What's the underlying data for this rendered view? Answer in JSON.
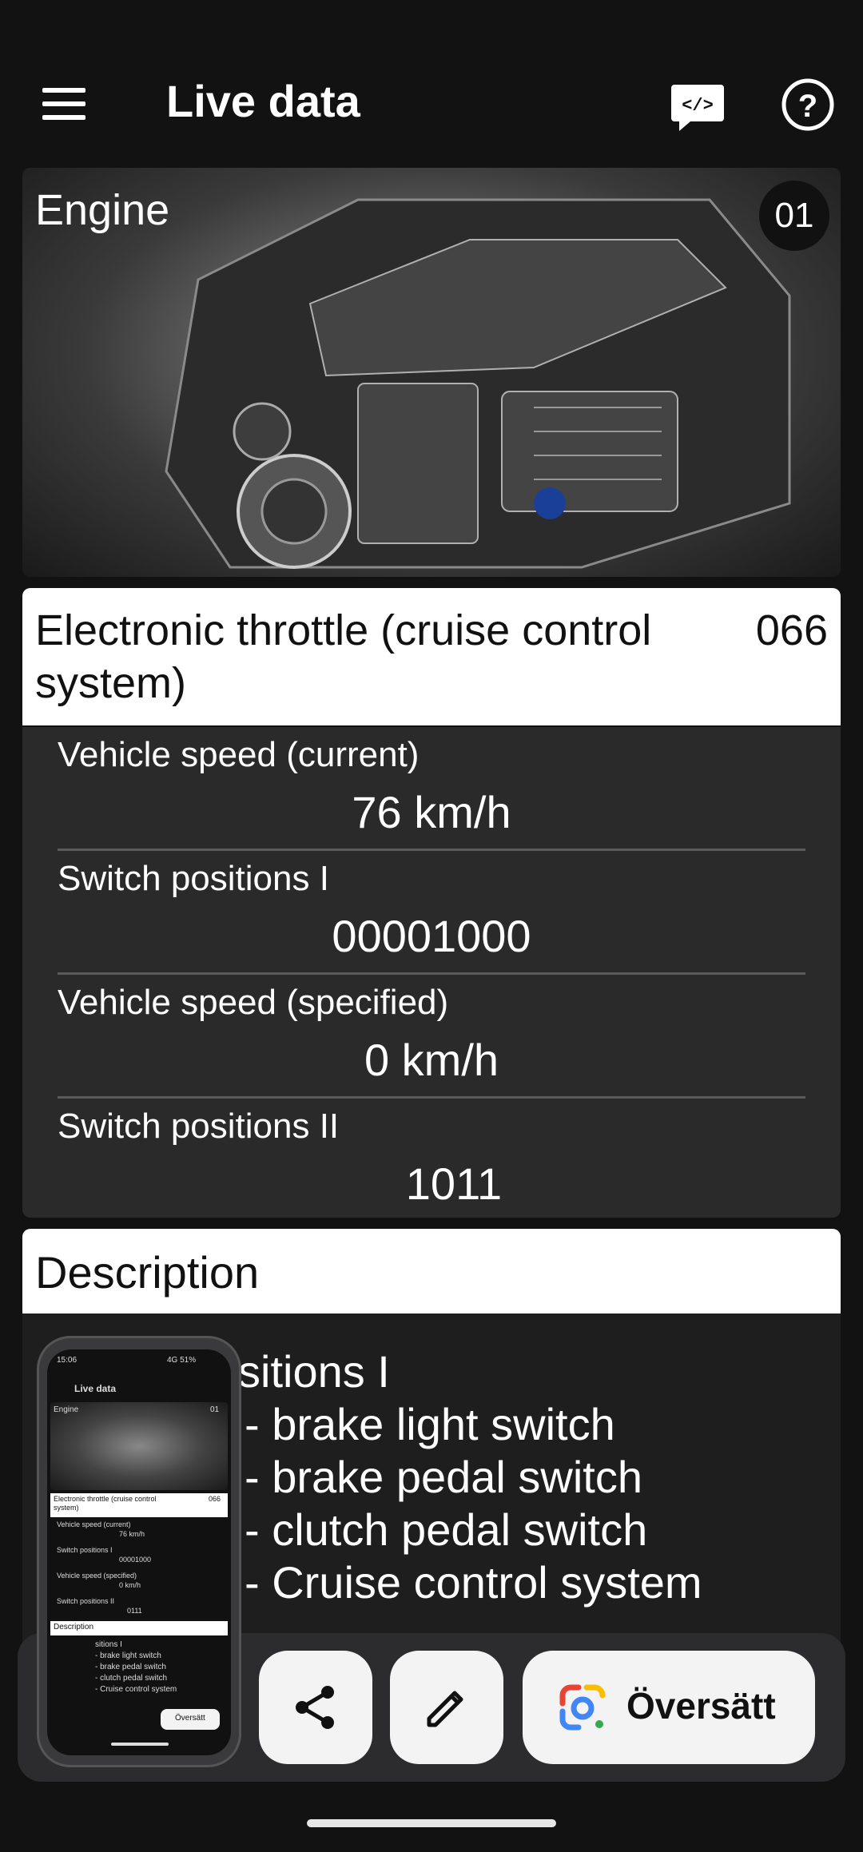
{
  "app_bar": {
    "title": "Live data",
    "menu_icon": "hamburger-menu-icon",
    "code_icon": "code-tag-icon",
    "code_icon_text": "</>",
    "help_icon": "help-circle-icon",
    "help_icon_text": "?"
  },
  "engine_card": {
    "title": "Engine",
    "badge": "01",
    "image": "engine-photo"
  },
  "group": {
    "title": "Electronic throttle (cruise control system)",
    "code": "066"
  },
  "values": [
    {
      "label": "Vehicle speed (current)",
      "value": "76 km/h"
    },
    {
      "label": "Switch positions I",
      "value": "00001000"
    },
    {
      "label": "Vehicle speed (specified)",
      "value": "0 km/h"
    },
    {
      "label": "Switch positions II",
      "value": "1011"
    }
  ],
  "description": {
    "title": "Description",
    "lines": [
      "sitions I",
      "- brake light switch",
      "- brake pedal switch",
      "- clutch pedal switch",
      "- Cruise control system"
    ]
  },
  "screenshot_overlay": {
    "share_icon": "share-icon",
    "edit_icon": "pencil-edit-icon",
    "translate_icon": "google-lens-icon",
    "translate_label": "Översätt",
    "thumbnail": {
      "time": "15:06",
      "status": "4G 51%",
      "title": "Live data",
      "engine": "Engine",
      "badge": "01",
      "group_title": "Electronic throttle (cruise control system)",
      "group_code": "066",
      "rows": [
        {
          "label": "Vehicle speed (current)",
          "value": "76 km/h"
        },
        {
          "label": "Switch positions I",
          "value": "00001000"
        },
        {
          "label": "Vehicle speed (specified)",
          "value": "0 km/h"
        },
        {
          "label": "Switch positions II",
          "value": "0111"
        }
      ],
      "desc_title": "Description",
      "desc_lines": [
        "sitions I",
        "- brake light switch",
        "- brake pedal switch",
        "- clutch pedal switch",
        "- Cruise control system"
      ],
      "translate_label": "Översätt"
    }
  }
}
